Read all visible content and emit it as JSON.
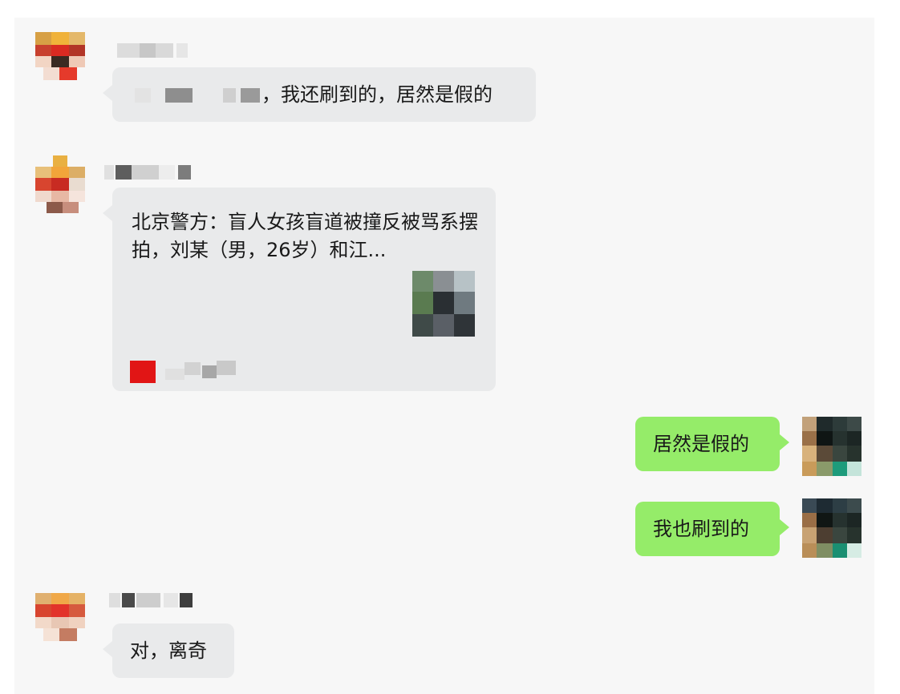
{
  "messages": [
    {
      "id": 1,
      "direction": "incoming",
      "sender_name": "",
      "text_tail": "，我还刷到的，居然是假的"
    },
    {
      "id": 2,
      "direction": "incoming",
      "sender_name": "",
      "type": "link-card",
      "card_title": "北京警方：盲人女孩盲道被撞反被骂系摆拍，刘某（男，26岁）和江...",
      "source_name": ""
    },
    {
      "id": 3,
      "direction": "outgoing",
      "text": "居然是假的"
    },
    {
      "id": 4,
      "direction": "outgoing",
      "text": "我也刷到的"
    },
    {
      "id": 5,
      "direction": "incoming",
      "sender_name": "",
      "text": "对，离奇"
    }
  ],
  "colors": {
    "chat_background": "#f7f7f7",
    "incoming_bubble": "#e9eaeb",
    "outgoing_bubble": "#95ec69",
    "source_logo": "#e11515"
  }
}
